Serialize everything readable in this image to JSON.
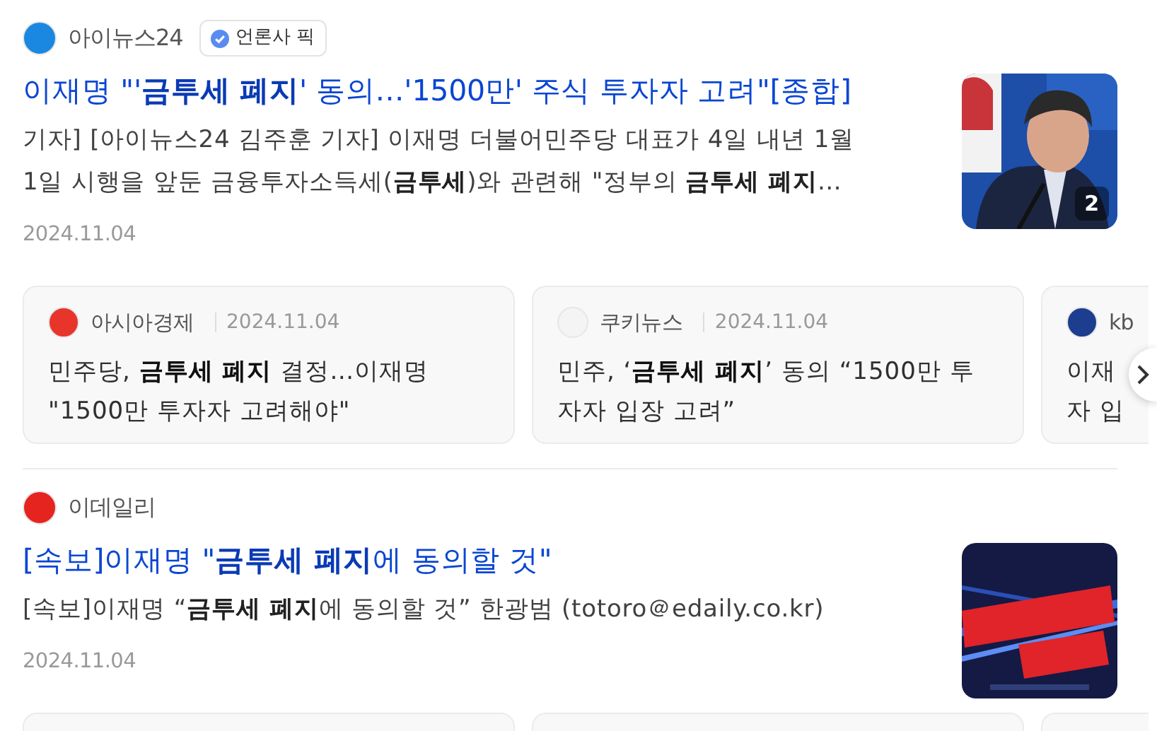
{
  "results": [
    {
      "source": {
        "name": "아이뉴스24",
        "color": "#1a88e0"
      },
      "badge": "언론사 픽",
      "title": "이재명 \"'**금투세 폐지**' 동의…'1500만' 주식 투자자 고려\"[종합]",
      "description": "기자] [아이뉴스24 김주훈 기자] 이재명 더불어민주당 대표가 4일 내년 1월 1일 시행을 앞둔 금융투자소득세(**금투세**)와 관련해 \"정부의 **금투세 폐지**…",
      "date": "2024.11.04",
      "thumbnail": {
        "kind": "picture",
        "count": "2"
      },
      "cards": [
        {
          "kind": "article",
          "source": {
            "name": "아시아경제",
            "color": "#e8352b"
          },
          "date": "2024.11.04",
          "title_lines": [
            "민주당, **금투세 폐지** 결정…이재명",
            "\"1500만 투자자 고려해야\""
          ]
        },
        {
          "kind": "article",
          "source": {
            "name": "쿠키뉴스",
            "color": "#f4f4f4"
          },
          "date": "2024.11.04",
          "title_lines": [
            "민주, ‘**금투세 폐지**’ 동의 “1500만 투",
            "자자 입장 고려”"
          ]
        },
        {
          "kind": "article",
          "source": {
            "name": "kb",
            "color": "#1d3d8f"
          },
          "title_lines": [
            "이재",
            "자 입"
          ]
        }
      ],
      "next_button": true
    },
    {
      "source": {
        "name": "이데일리",
        "color": "#e52420"
      },
      "title": "[속보]이재명 \"**금투세 폐지**에 동의할 것\"",
      "description": "[속보]이재명 “**금투세 폐지**에 동의할 것” 한광범 (totoro＠edaily.co.kr)",
      "date": "2024.11.04",
      "cards": [
        {
          "kind": "clipped"
        },
        {
          "kind": "clipped"
        },
        {
          "kind": "clipped"
        }
      ]
    }
  ]
}
